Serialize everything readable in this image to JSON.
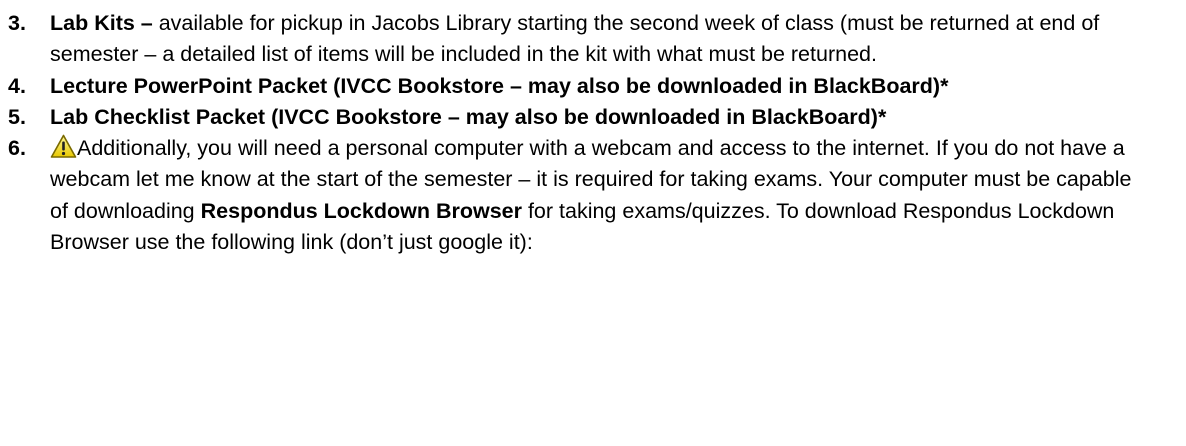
{
  "items": [
    {
      "number": "3.",
      "bold": "Lab Kits –",
      "text": " available for pickup in Jacobs Library starting the second week of class (must be returned at end of semester – a detailed list of items will be included in the kit with what must be returned."
    },
    {
      "number": "4.",
      "bold": "Lecture PowerPoint Packet (IVCC Bookstore – may also be downloaded in BlackBoard)*"
    },
    {
      "number": "5.",
      "bold": "Lab Checklist Packet (IVCC Bookstore – may also be downloaded in BlackBoard)*"
    },
    {
      "number": "6.",
      "icon": "warning-icon",
      "text_a": "Additionally, you will need a personal computer with a webcam and access to the internet. If you do not have a webcam let me know at the start of the semester – it is required for taking exams. Your computer must be capable of downloading ",
      "bold": "Respondus Lockdown Browser",
      "text_b": " for taking exams/quizzes. To download Respondus Lockdown Browser use the following link (don’t just google it):"
    }
  ],
  "colors": {
    "warning_fill": "#f7e400",
    "warning_stroke": "#7a6a00"
  }
}
